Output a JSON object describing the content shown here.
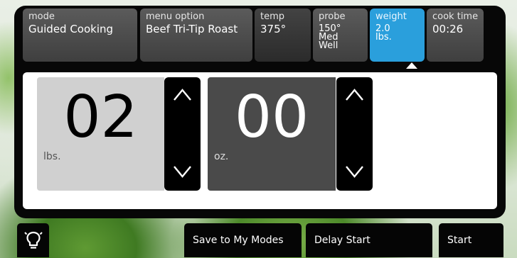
{
  "tabs": [
    {
      "label": "mode",
      "value": "Guided Cooking"
    },
    {
      "label": "menu option",
      "value": "Beef Tri-Tip Roast"
    },
    {
      "label": "temp",
      "value": "375°"
    },
    {
      "label": "probe",
      "value": "150°",
      "value2": "Med",
      "value3": "Well"
    },
    {
      "label": "weight",
      "value": "2.0",
      "value2": "lbs."
    },
    {
      "label": "cook time",
      "value": "00:26"
    }
  ],
  "weight": {
    "pounds": "02",
    "pounds_unit": "lbs.",
    "ounces": "00",
    "ounces_unit": "oz."
  },
  "footer": {
    "light_icon": "light-bulb-icon",
    "save_label": "Save to My Modes",
    "delay_label": "Delay Start",
    "start_label": "Start"
  },
  "colors": {
    "active_tab": "#2a9fdc",
    "panel": "#070707"
  }
}
